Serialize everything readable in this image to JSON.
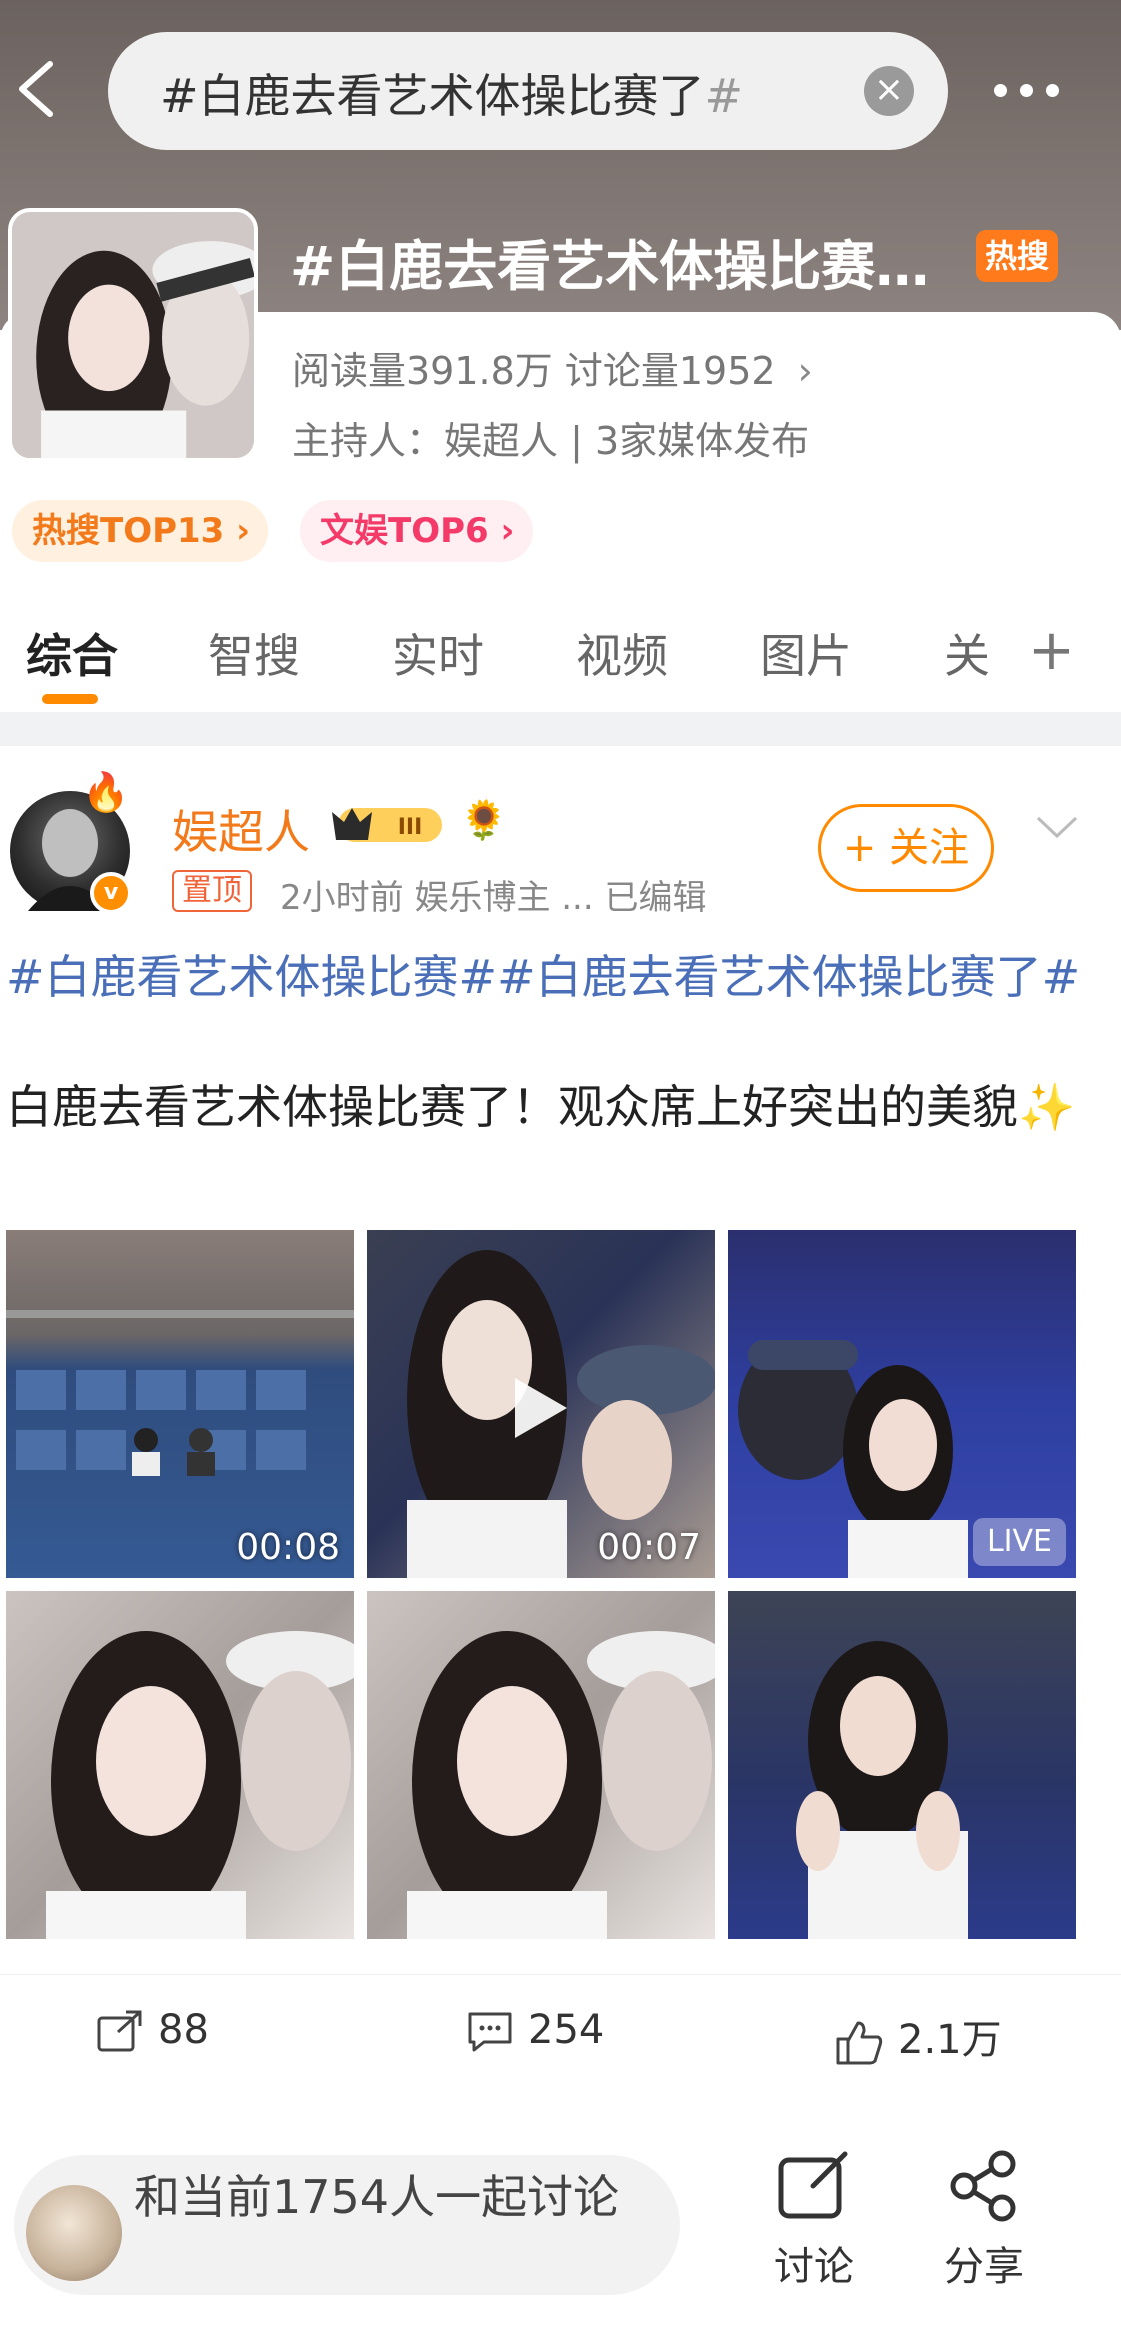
{
  "search": {
    "query": "#白鹿去看艺术体操比赛了",
    "hash_tail": "#"
  },
  "icons": {
    "back": "chevron-left-icon",
    "clear": "clear-icon",
    "more": "more-icon"
  },
  "topic": {
    "title": "#白鹿去看艺术体操比赛…",
    "hot_badge": "热搜",
    "stats": "阅读量391.8万  讨论量1952",
    "stats_chevron": "›",
    "host": "主持人：娱超人 | 3家媒体发布",
    "ranks": [
      "热搜TOP13 ›",
      "文娱TOP6 ›"
    ]
  },
  "tabs": [
    {
      "label": "综合",
      "active": true
    },
    {
      "label": "智搜",
      "active": false
    },
    {
      "label": "实时",
      "active": false
    },
    {
      "label": "视频",
      "active": false
    },
    {
      "label": "图片",
      "active": false
    },
    {
      "label": "关",
      "active": false
    }
  ],
  "tab_add": "+",
  "post": {
    "author": "娱超人",
    "level": "III",
    "pin": "置顶",
    "meta": "2小时前   娱乐博主 ...   已编辑",
    "follow": "+ 关注",
    "hashtags": "#白鹿看艺术体操比赛##白鹿去看艺术体操比赛了#",
    "text": "白鹿去看艺术体操比赛了！观众席上好突出的美貌✨",
    "media": [
      {
        "type": "video",
        "duration": "00:08"
      },
      {
        "type": "video",
        "duration": "00:07"
      },
      {
        "type": "live",
        "badge": "LIVE"
      },
      {
        "type": "image"
      },
      {
        "type": "image"
      },
      {
        "type": "image"
      }
    ],
    "actions": {
      "reposts": "88",
      "comments": "254",
      "likes": "2.1万"
    }
  },
  "bottom": {
    "discuss_placeholder": "和当前1754人一起讨论",
    "discuss_btn": "讨论",
    "share_btn": "分享"
  },
  "colors": {
    "accent": "#ff8a00",
    "link": "#4a6fb8",
    "hot": "#ff7a1a"
  }
}
